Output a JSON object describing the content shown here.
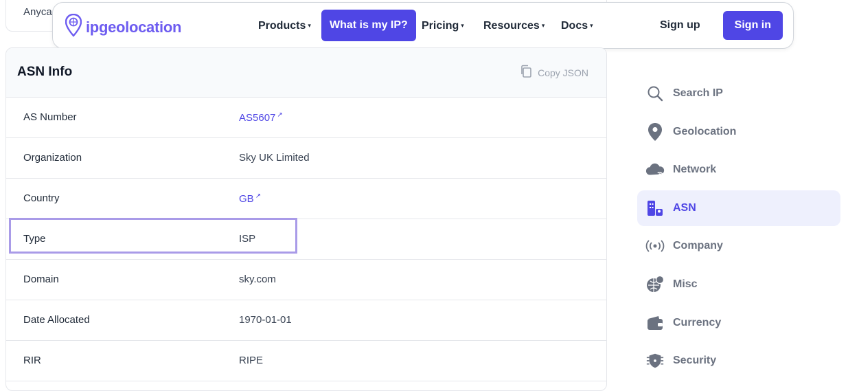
{
  "prev_card": {
    "label": "Anyca"
  },
  "nav": {
    "logo_text": "ipgeolocation",
    "items": [
      {
        "label": "Products",
        "caret": "▾"
      },
      {
        "label": "What is my IP?"
      },
      {
        "label": "Pricing",
        "caret": "▾"
      },
      {
        "label": "Resources",
        "caret": "▾"
      },
      {
        "label": "Docs",
        "caret": "▾"
      }
    ],
    "signup": "Sign up",
    "signin": "Sign in"
  },
  "card": {
    "title": "ASN Info",
    "copy_label": "Copy JSON",
    "rows": [
      {
        "label": "AS Number",
        "value": "AS5607",
        "ext": "↗"
      },
      {
        "label": "Organization",
        "value": "Sky UK Limited"
      },
      {
        "label": "Country",
        "value": "GB",
        "ext": "↗"
      },
      {
        "label": "Type",
        "value": "ISP"
      },
      {
        "label": "Domain",
        "value": "sky.com"
      },
      {
        "label": "Date Allocated",
        "value": "1970-01-01"
      },
      {
        "label": "RIR",
        "value": "RIPE"
      }
    ]
  },
  "sidebar": {
    "items": [
      {
        "label": "Search IP",
        "icon": "search-icon"
      },
      {
        "label": "Geolocation",
        "icon": "location-pin-icon"
      },
      {
        "label": "Network",
        "icon": "cloud-network-icon"
      },
      {
        "label": "ASN",
        "icon": "asn-building-icon",
        "active": true
      },
      {
        "label": "Company",
        "icon": "broadcast-icon"
      },
      {
        "label": "Misc",
        "icon": "globe-misc-icon"
      },
      {
        "label": "Currency",
        "icon": "wallet-icon"
      },
      {
        "label": "Security",
        "icon": "shield-virus-icon"
      }
    ]
  },
  "colors": {
    "accent": "#4f46e5",
    "logo": "#6d5cf0",
    "highlight": "#a99be8"
  }
}
